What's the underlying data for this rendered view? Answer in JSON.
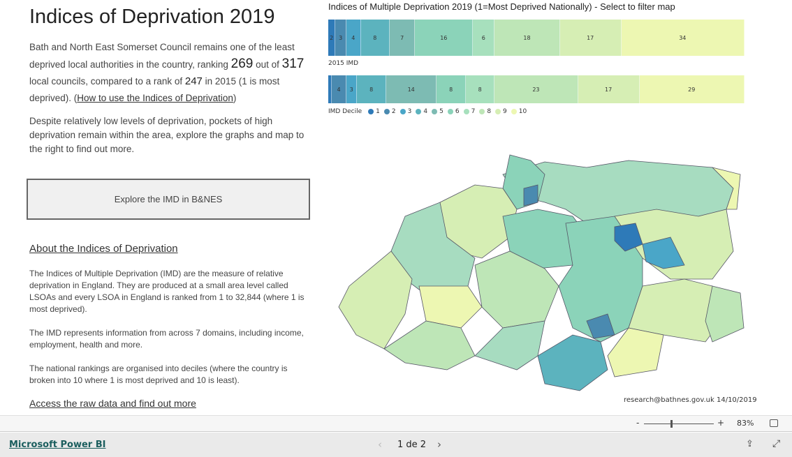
{
  "left": {
    "title": "Indices of Deprivation 2019",
    "intro_a": "Bath and North East Somerset Council remains one of the least deprived local authorities in the country, ranking ",
    "rank2019": "269",
    "intro_b": " out of ",
    "total": "317",
    "intro_c": " local councils, compared to a rank of ",
    "rank2015": "247",
    "intro_d": " in 2015 (1 is most deprived). (",
    "howto_link": "How to use the Indices of Deprivation",
    "intro_e": ")",
    "para2": "Despite relatively low levels of deprivation, pockets of high deprivation remain within the area, explore the graphs and map to the right to find out more.",
    "explore_button": "Explore the IMD in B&NES",
    "about_heading": "About the Indices of Deprivation",
    "about1": "The Indices of Multiple Deprivation (IMD) are the measure of relative deprivation in England. They are produced at a small area level called LSOAs and every LSOA in England is ranked from 1 to 32,844 (where 1 is most deprived).",
    "about2": "The IMD represents information from across 7 domains, including income, employment, health and more.",
    "about3": "The national rankings are organised into deciles (where the country is broken into 10 where 1 is most deprived and 10 is least).",
    "raw_link": "Access the raw data and find out more"
  },
  "chart_data": {
    "type": "bar",
    "title": "Indices of Multiple Deprivation 2019 (1=Most Deprived Nationally) - Select to filter map",
    "stacked": true,
    "orientation": "horizontal",
    "legend_title": "IMD Decile",
    "legend_position": "bottom",
    "categories": [
      "1",
      "2",
      "3",
      "4",
      "5",
      "6",
      "7",
      "8",
      "9",
      "10"
    ],
    "colors": [
      "#2e7ab8",
      "#4a8ab0",
      "#4aa6c8",
      "#5cb3be",
      "#7dbbb3",
      "#8bd3b9",
      "#a7e0bd",
      "#bee6b7",
      "#d6eeb4",
      "#edf7b2"
    ],
    "series": [
      {
        "name": "",
        "values": [
          2,
          3,
          4,
          8,
          7,
          16,
          6,
          18,
          17,
          34
        ]
      },
      {
        "name": "2015 IMD",
        "values": [
          1,
          4,
          3,
          8,
          14,
          8,
          8,
          23,
          17,
          29
        ]
      }
    ],
    "unlabeled_2015": [
      0
    ]
  },
  "map": {
    "credit": "research@bathnes.gov.uk 14/10/2019"
  },
  "zoom": {
    "minus": "-",
    "plus": "+",
    "level": "83%",
    "level_fraction": 0.5
  },
  "footer": {
    "brand": "Microsoft Power BI",
    "page": "1 de 2"
  }
}
